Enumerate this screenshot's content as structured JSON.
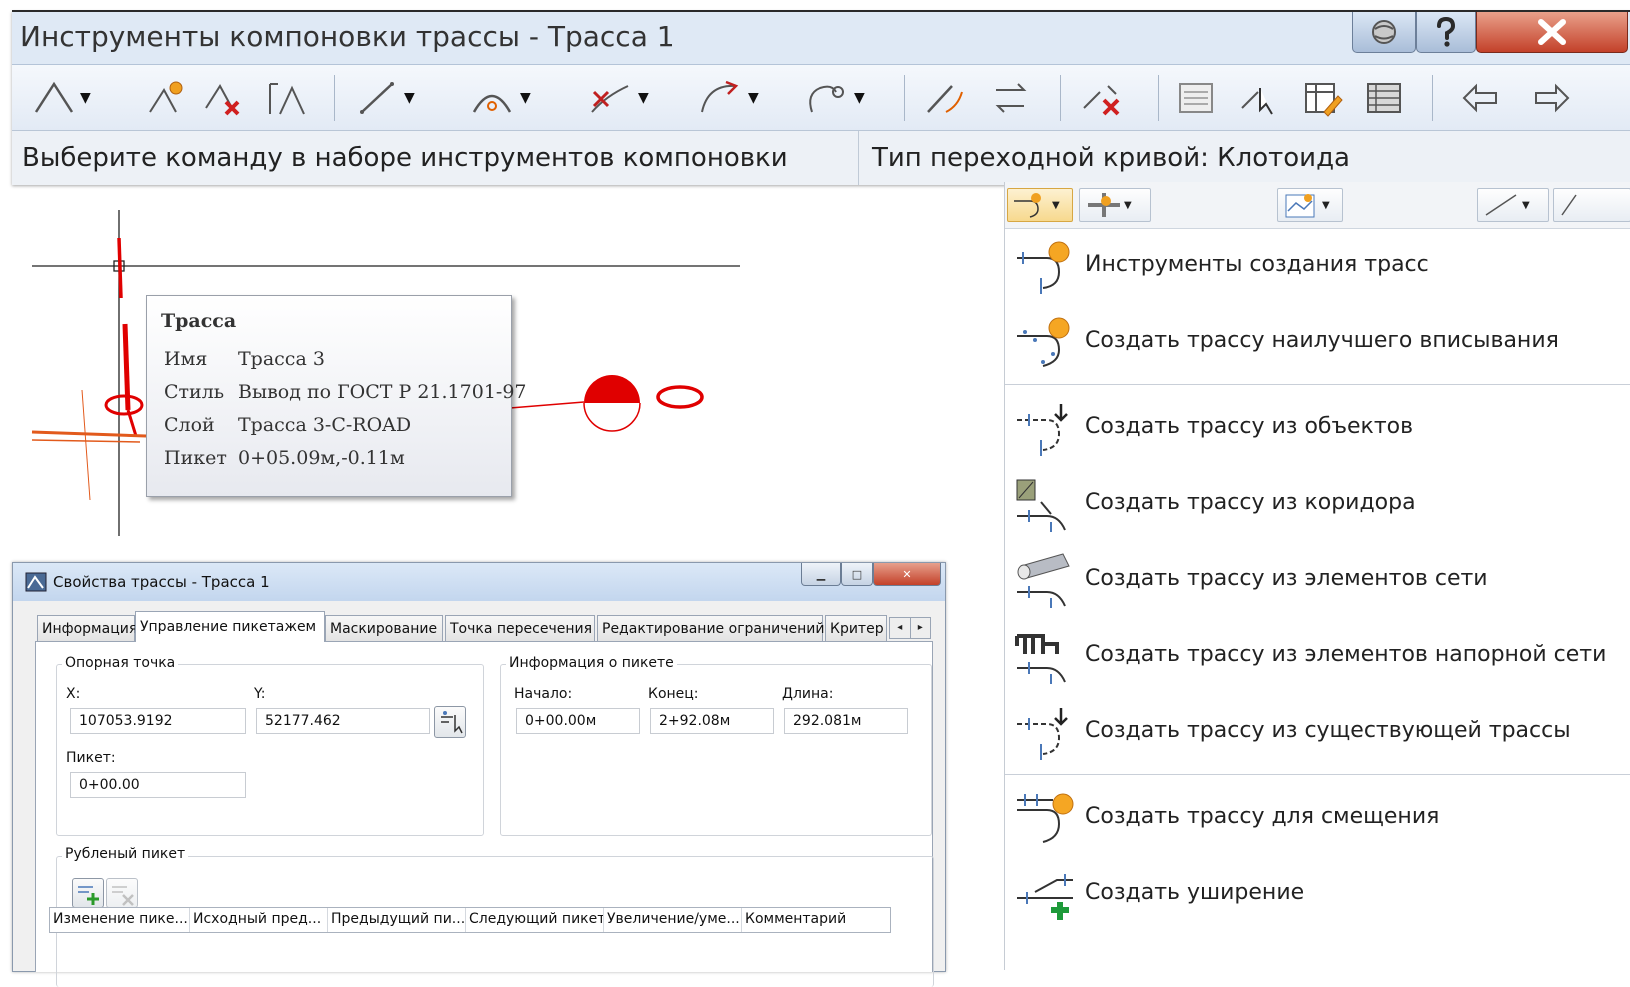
{
  "toolbar_window": {
    "title": "Инструменты компоновки трассы - Трасса 1",
    "status_left": "Выберите команду в наборе инструментов компоновки",
    "status_right": "Тип переходной кривой: Клотоида"
  },
  "tooltip": {
    "title": "Трасса",
    "rows": [
      {
        "label": "Имя",
        "value": "Трасса 3"
      },
      {
        "label": "Стиль",
        "value": "Вывод по ГОСТ Р 21.1701-97"
      },
      {
        "label": "Слой",
        "value": "Трасса 3-C-ROAD"
      },
      {
        "label": "Пикет",
        "value": "0+05.09м,-0.11м"
      }
    ]
  },
  "dialog": {
    "title": "Свойства трассы - Трасса 1",
    "tabs": [
      "Информация",
      "Управление пикетажем",
      "Маскирование",
      "Точка пересечения",
      "Редактирование ограничений",
      "Критер"
    ],
    "active_tab": "Управление пикетажем",
    "reference": {
      "group_label": "Опорная точка",
      "x_label": "X:",
      "x_value": "107053.9192",
      "y_label": "Y:",
      "y_value": "52177.462",
      "station_label": "Пикет:",
      "station_value": "0+00.00"
    },
    "station_info": {
      "group_label": "Информация о пикете",
      "start_label": "Начало:",
      "start_value": "0+00.00м",
      "end_label": "Конец:",
      "end_value": "2+92.08м",
      "length_label": "Длина:",
      "length_value": "292.081м"
    },
    "equations": {
      "group_label": "Рубленый пикет",
      "columns": [
        "Изменение пике...",
        "Исходный пред...",
        "Предыдущий пи...",
        "Следующий пикет",
        "Увеличение/уме...",
        "Комментарий"
      ]
    }
  },
  "menu": {
    "items": [
      {
        "label": "Инструменты создания трасс",
        "icon": "alignment-tools-icon"
      },
      {
        "label": "Создать трассу наилучшего вписывания",
        "icon": "best-fit-alignment-icon"
      },
      {
        "label": "Создать трассу из объектов",
        "icon": "alignment-from-objects-icon"
      },
      {
        "label": "Создать трассу из коридора",
        "icon": "alignment-from-corridor-icon"
      },
      {
        "label": "Создать трассу из элементов сети",
        "icon": "alignment-from-pipe-network-icon"
      },
      {
        "label": "Создать трассу из элементов напорной сети",
        "icon": "alignment-from-pressure-network-icon"
      },
      {
        "label": "Создать трассу из существующей трассы",
        "icon": "alignment-from-existing-icon"
      },
      {
        "label": "Создать трассу для смещения",
        "icon": "offset-alignment-icon"
      },
      {
        "label": "Создать уширение",
        "icon": "widening-icon"
      }
    ]
  },
  "colors": {
    "accent_red": "#e00000",
    "orange": "#e25a1c",
    "title_bar": "#dfe9f5"
  }
}
